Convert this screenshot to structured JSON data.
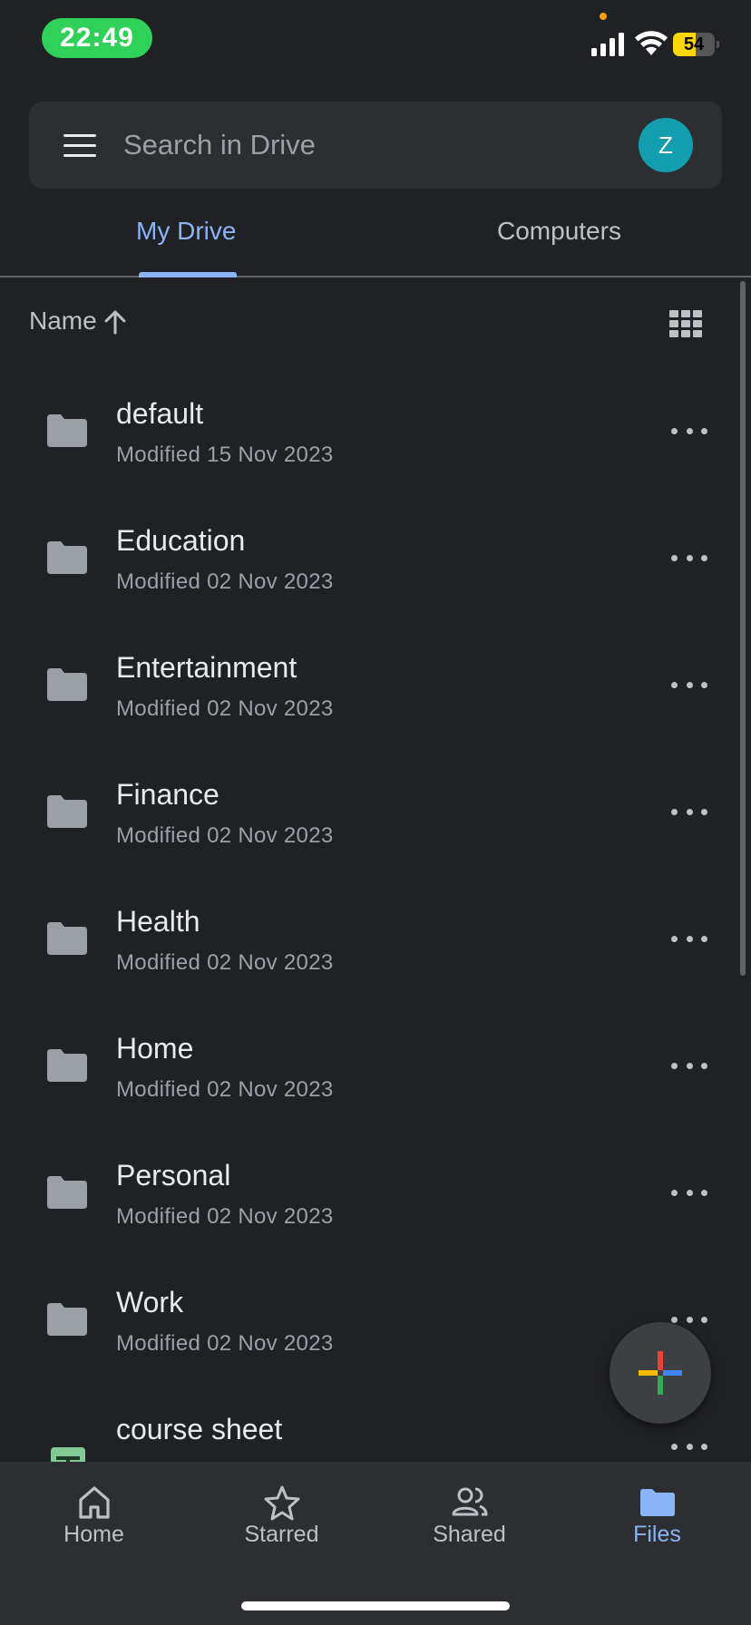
{
  "status_bar": {
    "time": "22:49",
    "battery": "54",
    "battery_level": 0.54
  },
  "search": {
    "placeholder": "Search in Drive",
    "avatar_letter": "Z"
  },
  "tabs": [
    {
      "label": "My Drive",
      "active": true
    },
    {
      "label": "Computers",
      "active": false
    }
  ],
  "sort": {
    "label": "Name"
  },
  "files": [
    {
      "name": "default",
      "meta": "Modified 15 Nov 2023",
      "type": "folder"
    },
    {
      "name": "Education",
      "meta": "Modified 02 Nov 2023",
      "type": "folder"
    },
    {
      "name": "Entertainment",
      "meta": "Modified 02 Nov 2023",
      "type": "folder"
    },
    {
      "name": "Finance",
      "meta": "Modified 02 Nov 2023",
      "type": "folder"
    },
    {
      "name": "Health",
      "meta": "Modified 02 Nov 2023",
      "type": "folder"
    },
    {
      "name": "Home",
      "meta": "Modified 02 Nov 2023",
      "type": "folder"
    },
    {
      "name": "Personal",
      "meta": "Modified 02 Nov 2023",
      "type": "folder"
    },
    {
      "name": "Work",
      "meta": "Modified 02 Nov 2023",
      "type": "folder"
    },
    {
      "name": "course sheet",
      "meta": "",
      "type": "spreadsheet"
    }
  ],
  "bottom_nav": [
    {
      "label": "Home",
      "icon": "home-icon",
      "active": false
    },
    {
      "label": "Starred",
      "icon": "star-icon",
      "active": false
    },
    {
      "label": "Shared",
      "icon": "people-icon",
      "active": false
    },
    {
      "label": "Files",
      "icon": "folder-icon",
      "active": true
    }
  ],
  "colors": {
    "background": "#202124",
    "surface": "#2d2e31",
    "accent": "#8ab4f8",
    "avatar": "#129eaf",
    "folder": "#9aa0a6"
  }
}
